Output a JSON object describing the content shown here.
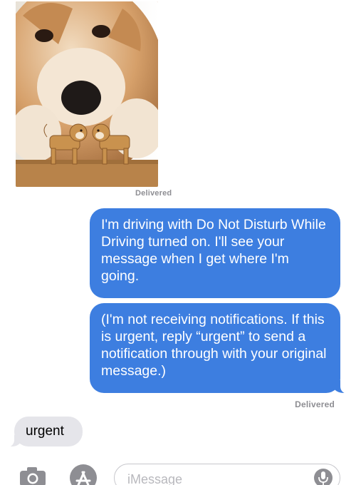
{
  "conversation": {
    "photo_receipt": "Delivered",
    "auto_reply_1": "I'm driving with Do Not Disturb While Driving turned on. I'll see your message when I get where I'm going.",
    "auto_reply_2": "(I'm not receiving notifications. If this is urgent, reply “urgent” to send a notification through with your original message.)",
    "reply_receipt": "Delivered",
    "incoming_message": "urgent"
  },
  "composer": {
    "placeholder": "iMessage",
    "camera_icon": "camera-icon",
    "appstore_icon": "app-store-icon",
    "mic_icon": "microphone-icon"
  },
  "colors": {
    "outgoing_bubble": "#3d7ee0",
    "incoming_bubble": "#e5e5ea",
    "receipt_text": "#8e8e93"
  }
}
